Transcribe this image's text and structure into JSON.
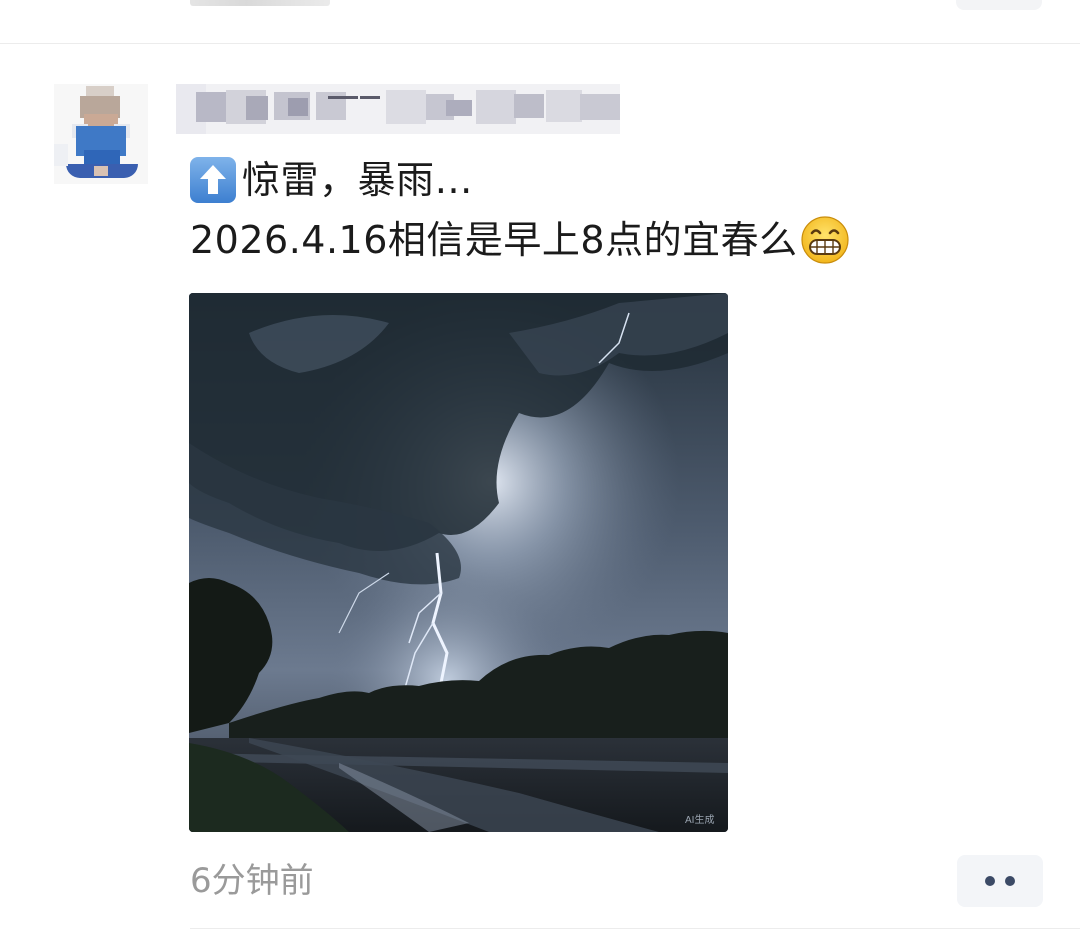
{
  "post": {
    "line1": "惊雷，暴雨…",
    "line2": "2026.4.16相信是早上8点的宜春么",
    "up_icon": "up-arrow-emoji-icon",
    "grin_icon": "grinning-face-emoji-icon",
    "photo_watermark": "AI生成"
  },
  "footer": {
    "time": "6分钟前",
    "more_icon": "two-dots-more-icon"
  },
  "colors": {
    "text": "#1b1b1b",
    "time": "#9a9a9a",
    "more_bg": "#f3f5f8",
    "more_dots": "#3b4a66"
  }
}
